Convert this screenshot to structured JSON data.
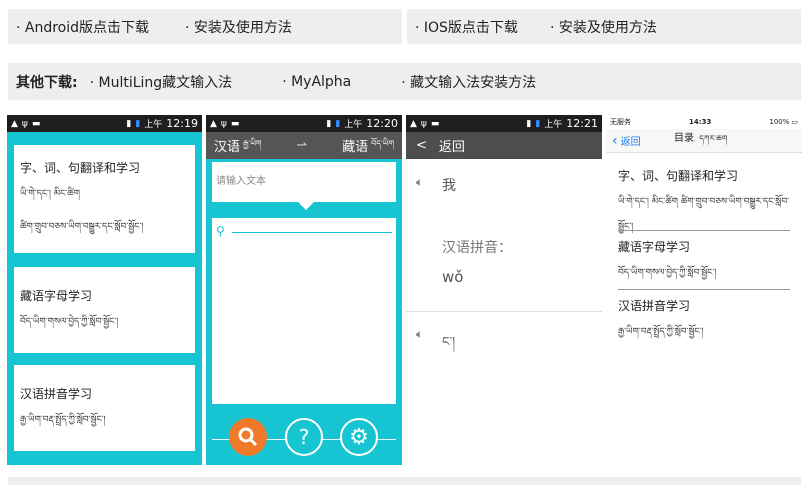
{
  "top_links": {
    "android": "· Android版点击下载",
    "android_install": "· 安装及使用方法",
    "ios": "· IOS版点击下载",
    "ios_install": "· 安装及使用方法"
  },
  "other": {
    "label": "其他下载:",
    "multiling": "· MultiLing藏文输入法",
    "myalpha": "· MyAlpha",
    "tibetan_install": "· 藏文输入法安装方法"
  },
  "phone1": {
    "time": "12:19",
    "ampm": "上午",
    "cards": [
      {
        "zh": "字、词、句翻译和学习",
        "bo1": "ཡི་གེ་དང་། མིང་ཚིག",
        "bo2": "ཚིག་གྲུབ་བཅས་ཡིག་བསྒྱུར་དང་སློབ་སྦྱོང་།"
      },
      {
        "zh": "藏语字母学习",
        "bo1": "བོད་ཡིག་གསལ་བྱེད་ཀྱི་སློབ་སྦྱོང་།"
      },
      {
        "zh": "汉语拼音学习",
        "bo1": "རྒྱ་ཡིག་བརྡ་སྤྲོད་ཀྱི་སློབ་སྦྱོང་།"
      }
    ]
  },
  "phone2": {
    "time": "12:20",
    "ampm": "上午",
    "lang_left": "汉语",
    "lang_left_bo": "རྒྱ་ཡིག",
    "lang_right": "藏语",
    "lang_right_bo": "བོད་ཡིག",
    "input_placeholder": "请输入文本",
    "help_glyph": "?"
  },
  "phone3": {
    "time": "12:21",
    "ampm": "上午",
    "back": "返回",
    "word": "我",
    "pinyin_label": "汉语拼音：",
    "pinyin": "wǒ",
    "tibetan": "ང་།"
  },
  "phone4": {
    "carrier": "无服务",
    "time": "14:33",
    "battery": "100%",
    "back": "返回",
    "title": "目录",
    "title_bo": "དཀར་ཆག",
    "rows": [
      {
        "zh": "字、词、句翻译和学习",
        "bo": "ཡི་གེ་དང་། མིང་ཚིག ཚིག་གྲུབ་བཅས་ཡིག་བསྒྱུར་དང་སློབ་སྦྱོང་།"
      },
      {
        "zh": "藏语字母学习",
        "bo": "བོད་ཡིག་གསལ་བྱེད་ཀྱི་སློབ་སྦྱོང་།"
      },
      {
        "zh": "汉语拼音学习",
        "bo": "རྒྱ་ཡིག་བརྡ་སྤྲོད་ཀྱི་སློབ་སྦྱོང་།"
      }
    ]
  },
  "colors": {
    "teal": "#17c4d2",
    "orange": "#f07a2a",
    "dark": "#1e1e1e",
    "ios_blue": "#1a7cf0"
  }
}
